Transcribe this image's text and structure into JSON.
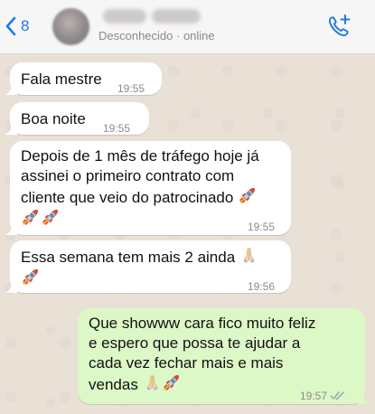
{
  "header": {
    "back_count": "8",
    "contact_status": "Desconhecido · online"
  },
  "messages": [
    {
      "text": "Fala mestre",
      "time": "19:55",
      "direction": "incoming"
    },
    {
      "text": "Boa noite",
      "time": "19:55",
      "direction": "incoming"
    },
    {
      "text_lines": [
        "Depois de 1 mês de tráfego hoje já",
        "assinei o primeiro contrato com",
        "cliente que veio do patrocinado"
      ],
      "emoji": [
        "rocket",
        "rocket",
        "rocket"
      ],
      "time": "19:55",
      "direction": "incoming"
    },
    {
      "text": "Essa semana tem mais 2 ainda",
      "emoji": [
        "folded-hands",
        "rocket"
      ],
      "time": "19:56",
      "direction": "incoming"
    },
    {
      "text_lines": [
        "Que showww cara fico muito feliz",
        "e espero que possa te ajudar a",
        "cada vez fechar mais e mais",
        "vendas"
      ],
      "emoji": [
        "folded-hands",
        "rocket"
      ],
      "time": "19:57",
      "direction": "outgoing",
      "status": "read"
    }
  ],
  "colors": {
    "accent": "#1f7ae0",
    "chat_background": "#e9e1d6",
    "incoming_bubble": "#ffffff",
    "outgoing_bubble": "#dcf8c6",
    "timestamp": "#8b8b8b"
  }
}
